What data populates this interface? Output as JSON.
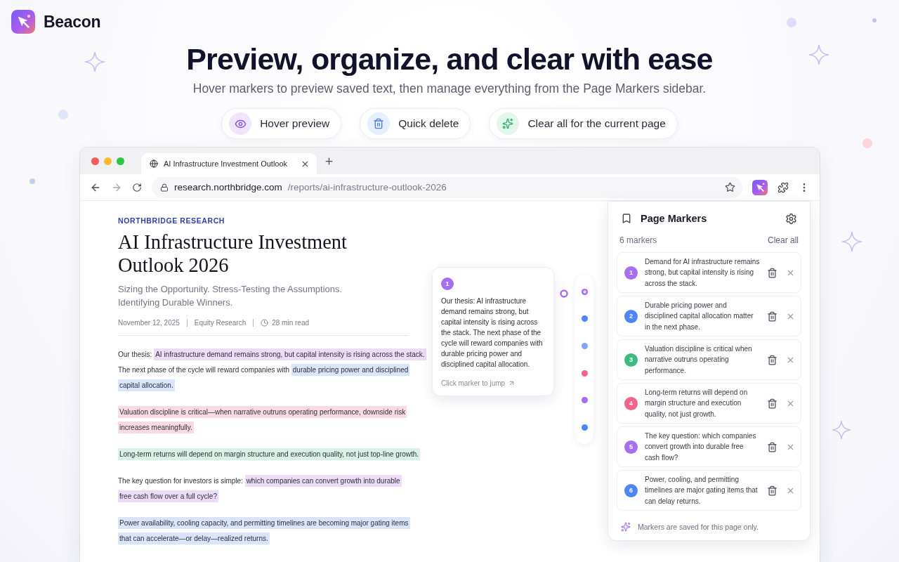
{
  "brand": {
    "name": "Beacon"
  },
  "hero": {
    "title": "Preview, organize, and clear with ease",
    "subtitle": "Hover markers to preview saved text, then manage everything from the Page Markers sidebar."
  },
  "features": [
    {
      "kind": "eye",
      "label": "Hover preview"
    },
    {
      "kind": "trash",
      "label": "Quick delete"
    },
    {
      "kind": "sparkle",
      "label": "Clear all for the current page"
    }
  ],
  "browser": {
    "tabs": [
      {
        "title": "AI Infrastructure Investment Outlook",
        "selected": true
      }
    ],
    "address": {
      "domain": "research.northbridge.com",
      "path": "/reports/ai-infrastructure-outlook-2026"
    }
  },
  "article": {
    "kicker": "NORTHBRIDGE RESEARCH",
    "title": "AI Infrastructure Investment Outlook 2026",
    "subtitle": "Sizing the Opportunity. Stress-Testing the Assumptions. Identifying Durable Winners.",
    "meta": [
      "November 12, 2025",
      "Equity Research",
      "28 min read"
    ],
    "paragraphs": [
      {
        "lines": [
          [
            {
              "text": "Our thesis: "
            },
            {
              "text": "AI infrastructure demand remains strong, but capital intensity is rising across the stack.",
              "color": "#ecdcf8"
            }
          ],
          [
            {
              "text": "The next phase of the cycle will reward companies with "
            },
            {
              "text": "durable pricing power and disciplined",
              "color": "#dae5fb"
            }
          ],
          [
            {
              "text": "capital allocation.",
              "color": "#dae5fb"
            }
          ]
        ]
      },
      {
        "lines": [
          [
            {
              "text": "Valuation discipline is critical—when narrative outruns operating performance, downside risk",
              "color": "#fbdbe3"
            }
          ],
          [
            {
              "text": "increases meaningfully.",
              "color": "#fbdbe3"
            }
          ]
        ]
      },
      {
        "lines": [
          [
            {
              "text": "Long-term returns will depend on margin structure and execution quality, not just top-line growth.",
              "color": "#d9f2e6"
            }
          ]
        ]
      },
      {
        "lines": [
          [
            {
              "text": "The key question for investors is simple: "
            },
            {
              "text": "which companies can convert growth into durable",
              "color": "#ecdcf8"
            }
          ],
          [
            {
              "text": "free cash flow over a full cycle?",
              "color": "#ecdcf8"
            }
          ]
        ]
      },
      {
        "lines": [
          [
            {
              "text": "Power availability, cooling capacity, and permitting timelines are becoming major gating items",
              "color": "#dae5fb"
            }
          ],
          [
            {
              "text": "that can accelerate—or delay—realized returns.",
              "color": "#dae5fb"
            }
          ]
        ]
      }
    ]
  },
  "preview": {
    "number": "1",
    "color": "#a66ff0",
    "text": "Our thesis: AI infrastructure demand remains strong, but capital intensity is rising across the stack. The next phase of the cycle will reward companies with durable pricing power and disciplined capital allocation.",
    "hint": "Click marker to jump"
  },
  "rail": {
    "markers": [
      {
        "color": "#a66ff0",
        "selected": true
      },
      {
        "color": "#4f86f7",
        "selected": false
      },
      {
        "color": "#7fa6f6",
        "selected": false
      },
      {
        "color": "#f2648a",
        "selected": false
      },
      {
        "color": "#a66ff0",
        "selected": false
      },
      {
        "color": "#4f86f7",
        "selected": false
      }
    ]
  },
  "sidebar": {
    "title": "Page Markers",
    "count": "6 markers",
    "clear_all": "Clear all",
    "markers": [
      {
        "number": "1",
        "color": "#a66ff0",
        "text": "Demand for AI infrastructure remains strong, but capital intensity is rising across the stack."
      },
      {
        "number": "2",
        "color": "#4f86f7",
        "text": "Durable pricing power and disciplined capital allocation matter in the next phase."
      },
      {
        "number": "3",
        "color": "#3dbb7e",
        "text": "Valuation discipline is critical when narrative outruns operating performance."
      },
      {
        "number": "4",
        "color": "#f2648a",
        "text": "Long-term returns will depend on margin structure and execution quality, not just growth."
      },
      {
        "number": "5",
        "color": "#a66ff0",
        "text": "The key question: which companies convert growth into durable free cash flow?"
      },
      {
        "number": "6",
        "color": "#4f86f7",
        "text": "Power, cooling, and permitting timelines are major gating items that can delay returns."
      }
    ],
    "footer": "Markers are saved for this page only."
  }
}
